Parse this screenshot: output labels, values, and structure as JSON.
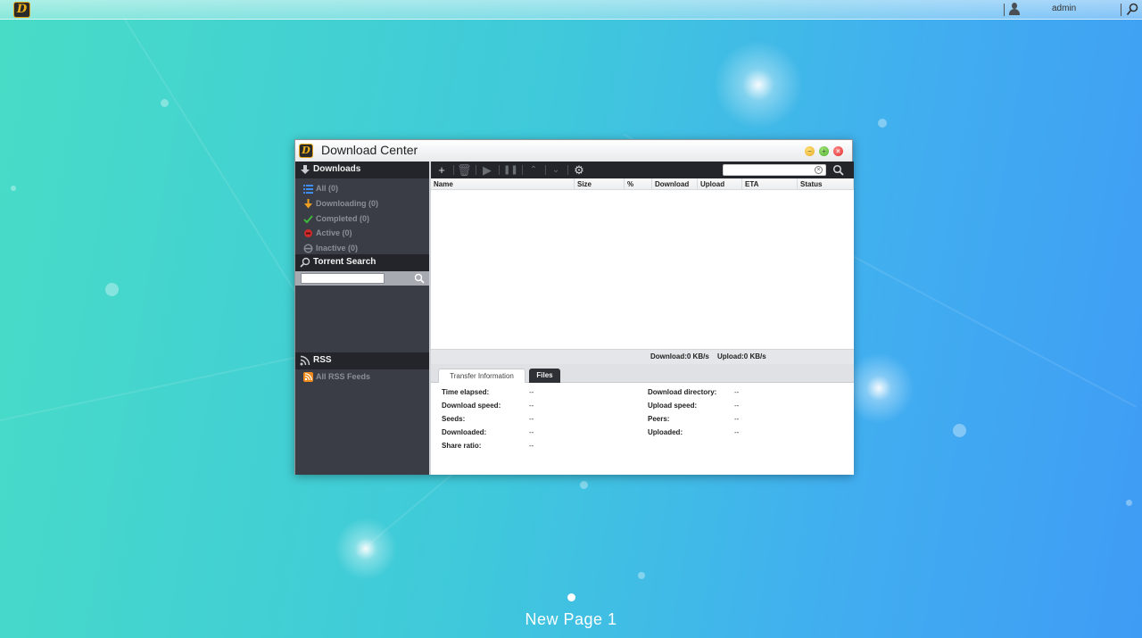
{
  "topbar": {
    "user_name": "admin"
  },
  "window": {
    "title": "Download Center",
    "controls": {
      "minimize": "–",
      "maximize": "+",
      "close": "×"
    }
  },
  "sidebar": {
    "downloads_header": "Downloads",
    "items": [
      {
        "label": "All (0)",
        "icon": "list-icon",
        "color": "#3d8ef0"
      },
      {
        "label": "Downloading (0)",
        "icon": "arrow-down-icon",
        "color": "#f0a020"
      },
      {
        "label": "Completed (0)",
        "icon": "checkmark-icon",
        "color": "#3fb63f"
      },
      {
        "label": "Active (0)",
        "icon": "active-icon",
        "color": "#d02a2a"
      },
      {
        "label": "Inactive (0)",
        "icon": "inactive-icon",
        "color": "#8a8e96"
      }
    ],
    "torrent_search_header": "Torrent Search",
    "rss_header": "RSS",
    "rss_items": [
      {
        "label": "All RSS Feeds",
        "icon": "rss-feed-icon",
        "color": "#f08a1c"
      }
    ]
  },
  "toolbar": {
    "buttons": [
      {
        "name": "add-button",
        "icon": "plus-icon",
        "glyph": "+",
        "enabled": true
      },
      {
        "name": "delete-button",
        "icon": "trash-icon",
        "glyph": "🗑",
        "enabled": false
      },
      {
        "name": "resume-button",
        "icon": "play-icon",
        "glyph": "▶",
        "enabled": false
      },
      {
        "name": "pause-button",
        "icon": "pause-icon",
        "glyph": "❚❚",
        "enabled": false
      },
      {
        "name": "move-top-button",
        "icon": "move-top-icon",
        "glyph": "⌃",
        "enabled": false
      },
      {
        "name": "move-bottom-button",
        "icon": "move-bottom-icon",
        "glyph": "⌄",
        "enabled": false
      },
      {
        "name": "settings-button",
        "icon": "gear-icon",
        "glyph": "⚙",
        "enabled": true
      }
    ],
    "search_value": ""
  },
  "table": {
    "columns": [
      "Name",
      "Size",
      "%",
      "Download",
      "Upload",
      "ETA",
      "Status"
    ],
    "rows": []
  },
  "speed": {
    "download": "Download:0 KB/s",
    "upload": "Upload:0 KB/s"
  },
  "tabs": {
    "transfer": "Transfer Information",
    "files": "Files"
  },
  "transfer_info": {
    "left": [
      {
        "label": "Time elapsed:",
        "value": "--"
      },
      {
        "label": "Download speed:",
        "value": "--"
      },
      {
        "label": "Seeds:",
        "value": "--"
      },
      {
        "label": "Downloaded:",
        "value": "--"
      },
      {
        "label": "Share ratio:",
        "value": "--"
      }
    ],
    "right": [
      {
        "label": "Download directory:",
        "value": "--"
      },
      {
        "label": "Upload speed:",
        "value": "--"
      },
      {
        "label": "Peers:",
        "value": "--"
      },
      {
        "label": "Uploaded:",
        "value": "--"
      }
    ]
  },
  "desktop": {
    "page_label": "New Page 1"
  }
}
